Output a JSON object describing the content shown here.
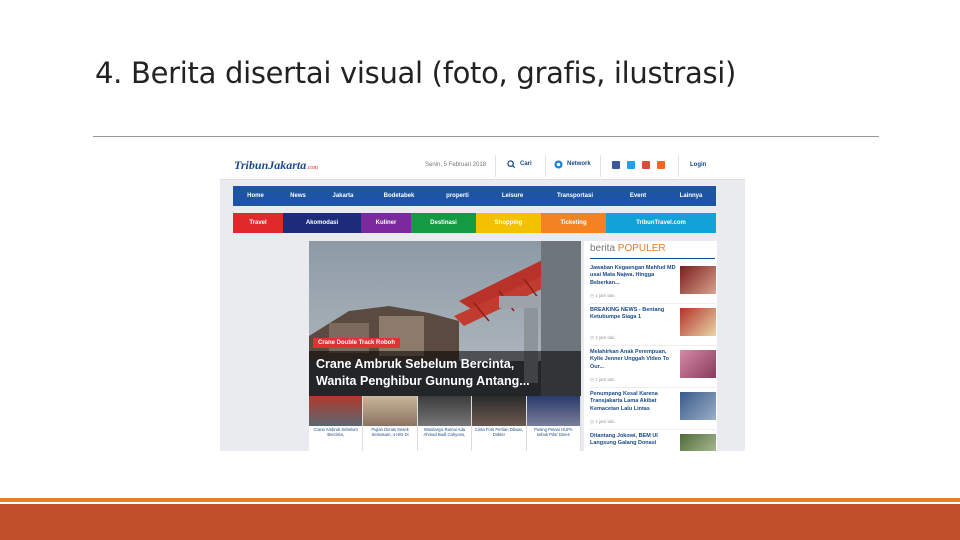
{
  "slide": {
    "title": "4. Berita disertai visual (foto, grafis, ilustrasi)"
  },
  "site": {
    "logo": "TribunJakarta",
    "logo_suffix": ".com",
    "date": "Senin, 5 Februari 2018",
    "cari": "Cari",
    "network": "Network",
    "login": "Login",
    "nav_primary": [
      "Home",
      "News",
      "Jakarta",
      "Bodetabek",
      "properti",
      "Leisure",
      "Transportasi",
      "Event",
      "Lainnya"
    ],
    "nav_secondary": [
      {
        "label": "Travel",
        "color": "#e0292b"
      },
      {
        "label": "Akomodasi",
        "color": "#1d2c7a"
      },
      {
        "label": "Kuliner",
        "color": "#7b2a9e"
      },
      {
        "label": "Destinasi",
        "color": "#159a44"
      },
      {
        "label": "Shopping",
        "color": "#f2c200"
      },
      {
        "label": "Ticketing",
        "color": "#f58220"
      },
      {
        "label": "TribunTravel.com",
        "color": "#11a3d8"
      }
    ],
    "hero": {
      "tag": "Crane Double Track Roboh",
      "headline_line1": "Crane Ambruk Sebelum Bercinta,",
      "headline_line2": "Wanita Penghibur Gunung Antang..."
    },
    "thumbs": [
      "Crane Ambruk Sebelum Bercinta,",
      "Pujian Dimas Sesek Semasam, 4 Hits Di",
      "Wanitanya Ramai Ada Ahmad Budi Cahyono,",
      "Cinta Foto Perlian Dibuat, Dokter",
      "Pusing Petani HUPA sebuk Pdsr Dines"
    ],
    "popular": {
      "label_prefix": "berita",
      "label_main": "POPULER",
      "items": [
        {
          "text": "Jawaban Kegaengan Mahfud MD usai Mata Najwa, Hingga Beberkan...",
          "time": "1 jam lalu"
        },
        {
          "text": "BREAKING NEWS - Bentang Ketubumpe Siaga 1",
          "time": "1 jam lalu"
        },
        {
          "text": "Melahirkan Anak Perempuan, Kylie Jenner Unggah Video To Our...",
          "time": "1 jam lalu"
        },
        {
          "text": "Penumpang Kesal Karena Transjakarta Lama Akibat Kemacetan Lalu Lintas",
          "time": "1 jam lalu"
        },
        {
          "text": "Ditantang Jokowi, BEM UI Langsung Galang Donasi",
          "time": ""
        }
      ]
    }
  }
}
